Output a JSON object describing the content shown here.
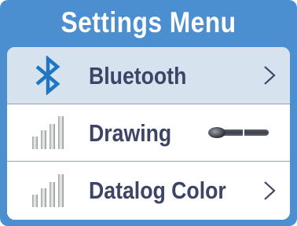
{
  "header": {
    "title": "Settings Menu"
  },
  "menu": {
    "items": [
      {
        "label": "Bluetooth",
        "icon": "bluetooth-icon",
        "control": "chevron",
        "selected": true
      },
      {
        "label": "Drawing",
        "icon": "bars-icon",
        "control": "toggle",
        "toggle_on": false
      },
      {
        "label": "Datalog Color",
        "icon": "bars-icon",
        "control": "chevron",
        "selected": false
      }
    ]
  },
  "colors": {
    "frame": "#4b8fd0",
    "selected_row": "#d6e3ef",
    "label_text": "#3e4466",
    "bluetooth": "#1f77c4"
  }
}
